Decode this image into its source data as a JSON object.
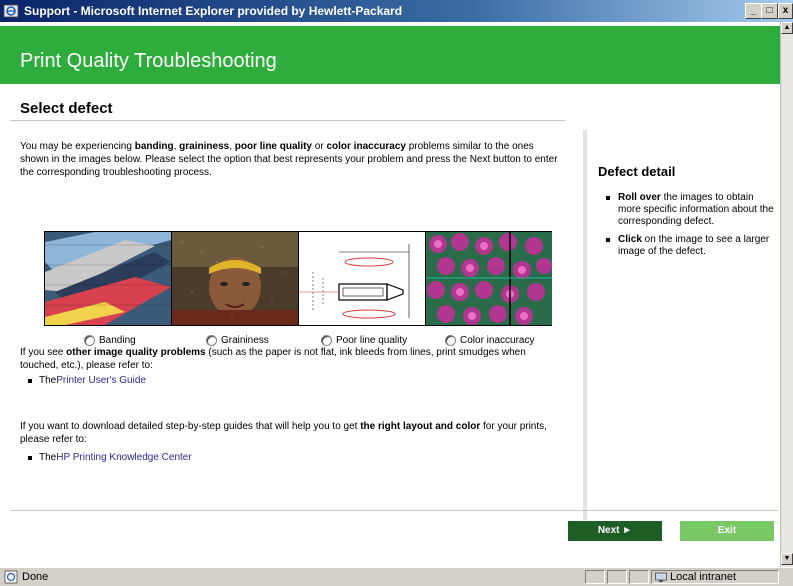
{
  "window": {
    "title": "Support - Microsoft Internet Explorer provided by Hewlett-Packard",
    "minimize_label": "_",
    "maximize_label": "□",
    "close_label": "x"
  },
  "page": {
    "banner_title": "Print Quality Troubleshooting",
    "section_title": "Select defect",
    "intro": {
      "t1": "You may be experiencing ",
      "banding": "banding",
      "t2": ", ",
      "graininess": "graininess",
      "t3": ", ",
      "poor_line": "poor line quality",
      "t4": " or ",
      "color_inacc": "color inaccuracy",
      "t5": " problems similar to the ones shown in the images below. Please select the option that best represents your problem and press the Next button to enter the corresponding troubleshooting process."
    },
    "options": [
      {
        "label": "Banding",
        "image": "kayaks-banding-image"
      },
      {
        "label": "Graininess",
        "image": "grainy-portrait-image"
      },
      {
        "label": "Poor line quality",
        "image": "technical-drawing-image"
      },
      {
        "label": "Color inaccuracy",
        "image": "flower-pattern-image"
      }
    ],
    "other_problems": {
      "t1": "If you see ",
      "bold": "other image quality problems",
      "t2": " (such as the paper is not flat, ink bleeds from lines, print smudges when touched, etc.), please refer to:",
      "item_prefix": "The ",
      "item_link": "Printer User's Guide"
    },
    "download": {
      "t1": "If you want to download detailed step-by-step guides that will help you to get ",
      "bold": "the right layout and color",
      "t2": " for your prints, please refer to:",
      "item_prefix": "The ",
      "item_link": "HP Printing Knowledge Center"
    },
    "detail": {
      "title": "Defect detail",
      "items": [
        {
          "bold": "Roll over",
          "text": " the images to obtain more specific information about the corresponding defect."
        },
        {
          "bold": "Click",
          "text": " on the image to see a larger image of the defect."
        }
      ]
    },
    "buttons": {
      "next": "Next ►",
      "exit": "Exit"
    }
  },
  "statusbar": {
    "status": "Done",
    "zone": "Local intranet"
  },
  "colors": {
    "banner": "#2fad3c",
    "next_button": "#1d5e27",
    "exit_button": "#78c965",
    "link": "#2a2a8c"
  }
}
